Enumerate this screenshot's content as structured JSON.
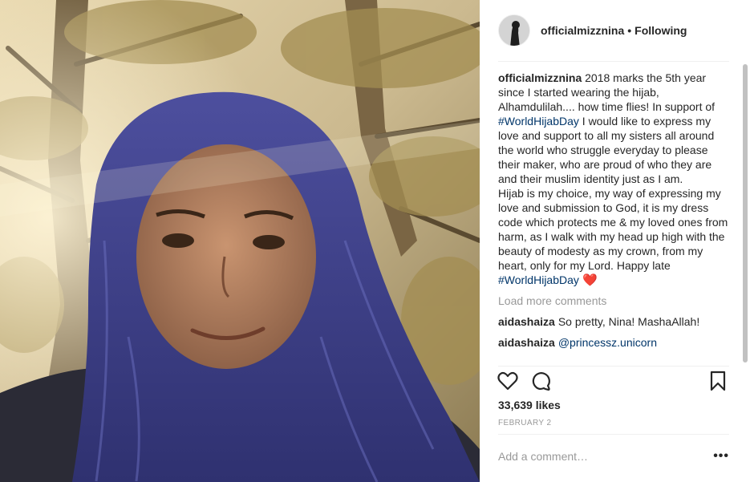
{
  "post": {
    "username": "officialmizznina",
    "separator": "•",
    "follow_status": "Following",
    "caption": {
      "username": "officialmizznina",
      "part1": " 2018 marks the 5th year since I started wearing the hijab, Alhamdulilah.... how time flies! In support of ",
      "hashtag1": "#WorldHijabDay",
      "part2": " I would like to express my love and support to all my sisters all around the world who struggle everyday to please their maker, who are proud of who they are and their muslim identity just as I am.\nHijab is my choice, my way of expressing my love and submission to God, it is my dress code which protects me & my loved ones from harm, as I walk with my head up high with the beauty of modesty as my crown, from my heart, only for my Lord. Happy late ",
      "hashtag2": "#WorldHijabDay",
      "emoji": " ❤️"
    },
    "load_more_label": "Load more comments",
    "comments": [
      {
        "username": "aidashaiza",
        "text": "So pretty, Nina! MashaAllah!"
      },
      {
        "username": "aidashaiza",
        "mention": "@princessz.unicorn"
      }
    ],
    "likes": "33,639 likes",
    "date": "FEBRUARY 2",
    "comment_placeholder": "Add a comment…",
    "more_label": "•••",
    "icons": [
      "heart-icon",
      "comment-icon",
      "bookmark-icon"
    ],
    "colors": {
      "hashtag": "#003569",
      "muted": "#999999",
      "text": "#262626"
    }
  }
}
